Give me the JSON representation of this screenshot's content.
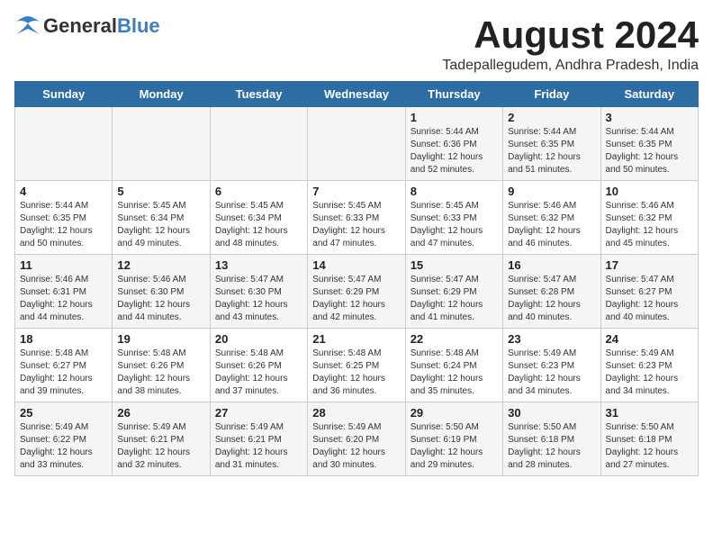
{
  "header": {
    "logo_general": "General",
    "logo_blue": "Blue",
    "month_title": "August 2024",
    "location": "Tadepallegudem, Andhra Pradesh, India"
  },
  "weekdays": [
    "Sunday",
    "Monday",
    "Tuesday",
    "Wednesday",
    "Thursday",
    "Friday",
    "Saturday"
  ],
  "weeks": [
    [
      {
        "day": "",
        "detail": ""
      },
      {
        "day": "",
        "detail": ""
      },
      {
        "day": "",
        "detail": ""
      },
      {
        "day": "",
        "detail": ""
      },
      {
        "day": "1",
        "detail": "Sunrise: 5:44 AM\nSunset: 6:36 PM\nDaylight: 12 hours\nand 52 minutes."
      },
      {
        "day": "2",
        "detail": "Sunrise: 5:44 AM\nSunset: 6:35 PM\nDaylight: 12 hours\nand 51 minutes."
      },
      {
        "day": "3",
        "detail": "Sunrise: 5:44 AM\nSunset: 6:35 PM\nDaylight: 12 hours\nand 50 minutes."
      }
    ],
    [
      {
        "day": "4",
        "detail": "Sunrise: 5:44 AM\nSunset: 6:35 PM\nDaylight: 12 hours\nand 50 minutes."
      },
      {
        "day": "5",
        "detail": "Sunrise: 5:45 AM\nSunset: 6:34 PM\nDaylight: 12 hours\nand 49 minutes."
      },
      {
        "day": "6",
        "detail": "Sunrise: 5:45 AM\nSunset: 6:34 PM\nDaylight: 12 hours\nand 48 minutes."
      },
      {
        "day": "7",
        "detail": "Sunrise: 5:45 AM\nSunset: 6:33 PM\nDaylight: 12 hours\nand 47 minutes."
      },
      {
        "day": "8",
        "detail": "Sunrise: 5:45 AM\nSunset: 6:33 PM\nDaylight: 12 hours\nand 47 minutes."
      },
      {
        "day": "9",
        "detail": "Sunrise: 5:46 AM\nSunset: 6:32 PM\nDaylight: 12 hours\nand 46 minutes."
      },
      {
        "day": "10",
        "detail": "Sunrise: 5:46 AM\nSunset: 6:32 PM\nDaylight: 12 hours\nand 45 minutes."
      }
    ],
    [
      {
        "day": "11",
        "detail": "Sunrise: 5:46 AM\nSunset: 6:31 PM\nDaylight: 12 hours\nand 44 minutes."
      },
      {
        "day": "12",
        "detail": "Sunrise: 5:46 AM\nSunset: 6:30 PM\nDaylight: 12 hours\nand 44 minutes."
      },
      {
        "day": "13",
        "detail": "Sunrise: 5:47 AM\nSunset: 6:30 PM\nDaylight: 12 hours\nand 43 minutes."
      },
      {
        "day": "14",
        "detail": "Sunrise: 5:47 AM\nSunset: 6:29 PM\nDaylight: 12 hours\nand 42 minutes."
      },
      {
        "day": "15",
        "detail": "Sunrise: 5:47 AM\nSunset: 6:29 PM\nDaylight: 12 hours\nand 41 minutes."
      },
      {
        "day": "16",
        "detail": "Sunrise: 5:47 AM\nSunset: 6:28 PM\nDaylight: 12 hours\nand 40 minutes."
      },
      {
        "day": "17",
        "detail": "Sunrise: 5:47 AM\nSunset: 6:27 PM\nDaylight: 12 hours\nand 40 minutes."
      }
    ],
    [
      {
        "day": "18",
        "detail": "Sunrise: 5:48 AM\nSunset: 6:27 PM\nDaylight: 12 hours\nand 39 minutes."
      },
      {
        "day": "19",
        "detail": "Sunrise: 5:48 AM\nSunset: 6:26 PM\nDaylight: 12 hours\nand 38 minutes."
      },
      {
        "day": "20",
        "detail": "Sunrise: 5:48 AM\nSunset: 6:26 PM\nDaylight: 12 hours\nand 37 minutes."
      },
      {
        "day": "21",
        "detail": "Sunrise: 5:48 AM\nSunset: 6:25 PM\nDaylight: 12 hours\nand 36 minutes."
      },
      {
        "day": "22",
        "detail": "Sunrise: 5:48 AM\nSunset: 6:24 PM\nDaylight: 12 hours\nand 35 minutes."
      },
      {
        "day": "23",
        "detail": "Sunrise: 5:49 AM\nSunset: 6:23 PM\nDaylight: 12 hours\nand 34 minutes."
      },
      {
        "day": "24",
        "detail": "Sunrise: 5:49 AM\nSunset: 6:23 PM\nDaylight: 12 hours\nand 34 minutes."
      }
    ],
    [
      {
        "day": "25",
        "detail": "Sunrise: 5:49 AM\nSunset: 6:22 PM\nDaylight: 12 hours\nand 33 minutes."
      },
      {
        "day": "26",
        "detail": "Sunrise: 5:49 AM\nSunset: 6:21 PM\nDaylight: 12 hours\nand 32 minutes."
      },
      {
        "day": "27",
        "detail": "Sunrise: 5:49 AM\nSunset: 6:21 PM\nDaylight: 12 hours\nand 31 minutes."
      },
      {
        "day": "28",
        "detail": "Sunrise: 5:49 AM\nSunset: 6:20 PM\nDaylight: 12 hours\nand 30 minutes."
      },
      {
        "day": "29",
        "detail": "Sunrise: 5:50 AM\nSunset: 6:19 PM\nDaylight: 12 hours\nand 29 minutes."
      },
      {
        "day": "30",
        "detail": "Sunrise: 5:50 AM\nSunset: 6:18 PM\nDaylight: 12 hours\nand 28 minutes."
      },
      {
        "day": "31",
        "detail": "Sunrise: 5:50 AM\nSunset: 6:18 PM\nDaylight: 12 hours\nand 27 minutes."
      }
    ]
  ]
}
